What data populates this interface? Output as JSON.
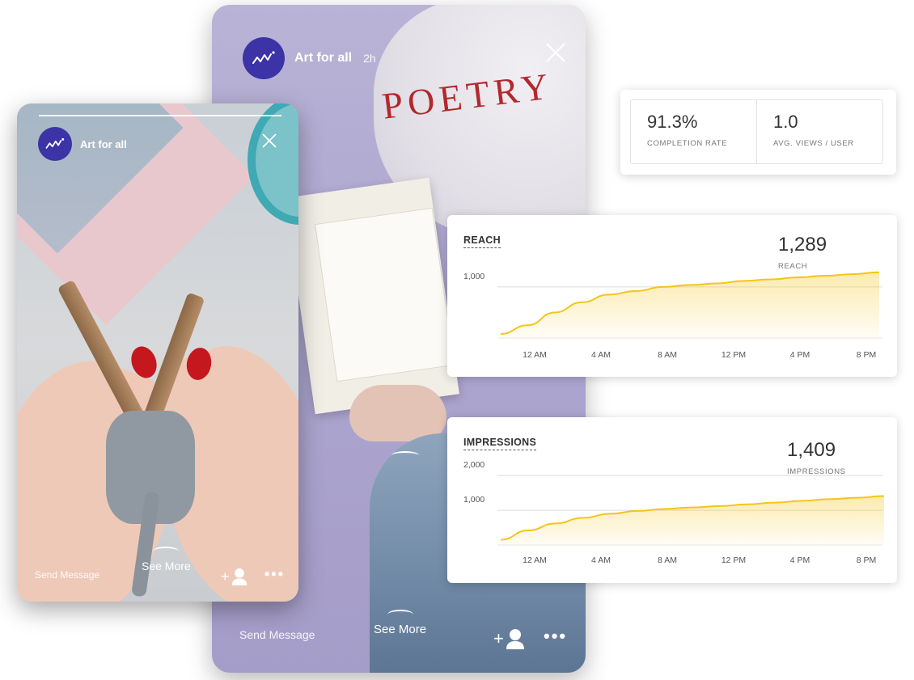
{
  "back_story": {
    "account": "Art for all",
    "time": "2h",
    "shirt_text": "POETRY",
    "see_more": "See More",
    "send_message": "Send Message",
    "add_user_plus": "+",
    "more": "•••"
  },
  "front_story": {
    "account": "Art for all",
    "see_more": "See More",
    "send_message": "Send Message",
    "add_user_plus": "+",
    "more": "•••"
  },
  "stats": {
    "completion_rate": {
      "value": "91.3%",
      "label": "COMPLETION RATE"
    },
    "avg_views": {
      "value": "1.0",
      "label": "AVG. VIEWS / USER"
    }
  },
  "colors": {
    "accent": "#f5c518",
    "avatar": "#3b33a6"
  },
  "chart_data": [
    {
      "type": "area",
      "title": "REACH",
      "summary_value": "1,289",
      "summary_label": "REACH",
      "x": [
        "12 AM",
        "4 AM",
        "8 AM",
        "12 PM",
        "4 PM",
        "8 PM"
      ],
      "ytick_labels": [
        "1,000"
      ],
      "yticks": [
        1000
      ],
      "ylim": [
        0,
        1300
      ],
      "grid": true,
      "series": [
        {
          "values": [
            80,
            250,
            500,
            700,
            850,
            920,
            1000,
            1040,
            1070,
            1120,
            1150,
            1190,
            1220,
            1250,
            1289
          ]
        }
      ]
    },
    {
      "type": "area",
      "title": "IMPRESSIONS",
      "summary_value": "1,409",
      "summary_label": "IMPRESSIONS",
      "x": [
        "12 AM",
        "4 AM",
        "8 AM",
        "12 PM",
        "4 PM",
        "8 PM"
      ],
      "ytick_labels": [
        "1,000",
        "2,000"
      ],
      "yticks": [
        1000,
        2000
      ],
      "ylim": [
        0,
        2050
      ],
      "grid": true,
      "series": [
        {
          "values": [
            150,
            420,
            620,
            780,
            900,
            980,
            1040,
            1080,
            1120,
            1170,
            1220,
            1270,
            1320,
            1360,
            1409
          ]
        }
      ]
    }
  ]
}
